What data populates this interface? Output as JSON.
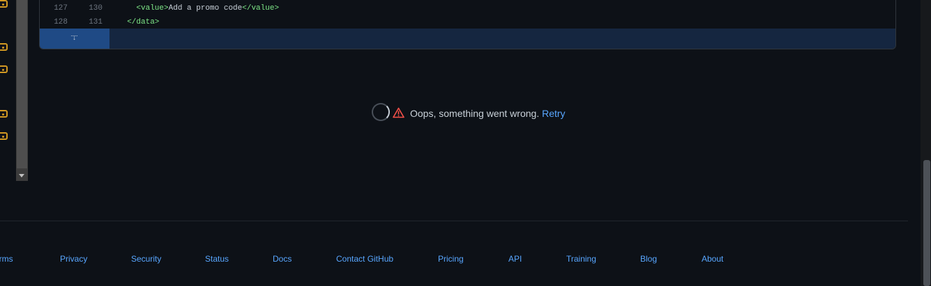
{
  "diff": {
    "lines": [
      {
        "old": "127",
        "new": "130",
        "indent": "    ",
        "open_tag": "<value>",
        "text": "Add a promo code",
        "close_tag": "</value>"
      },
      {
        "old": "128",
        "new": "131",
        "indent": "  ",
        "open_tag": "",
        "text": "",
        "close_tag": "</data>"
      }
    ]
  },
  "error": {
    "message": "Oops, something went wrong.",
    "retry_label": "Retry"
  },
  "footer": {
    "links": [
      "Terms",
      "Privacy",
      "Security",
      "Status",
      "Docs",
      "Contact GitHub",
      "Pricing",
      "API",
      "Training",
      "Blog",
      "About"
    ]
  },
  "colors": {
    "background": "#0d1117",
    "link": "#58a6ff",
    "warning": "#f85149",
    "tag": "#7ee787",
    "marker": "#d29922"
  }
}
